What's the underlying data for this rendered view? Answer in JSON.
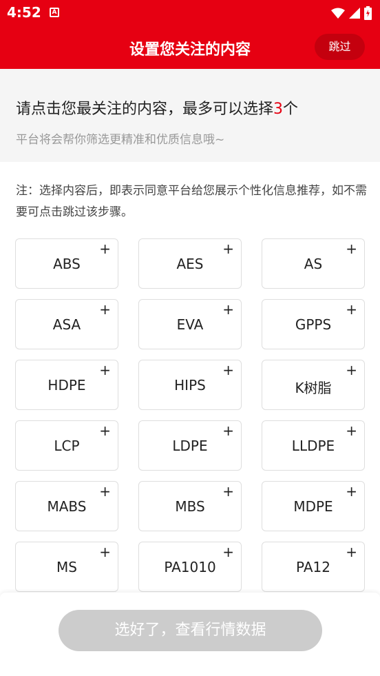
{
  "status_bar": {
    "time": "4:52",
    "notification_icon": "A"
  },
  "app_bar": {
    "title": "设置您关注的内容",
    "skip_label": "跳过"
  },
  "intro": {
    "title_prefix": "请点击您最关注的内容，最多可以选择",
    "title_max": "3",
    "title_suffix": "个",
    "subtitle": "平台将会帮你筛选更精准和优质信息哦~"
  },
  "note": "注：选择内容后，即表示同意平台给您展示个性化信息推荐，如不需要可点击跳过该步骤。",
  "tags": [
    {
      "label": "ABS"
    },
    {
      "label": "AES"
    },
    {
      "label": "AS"
    },
    {
      "label": "ASA"
    },
    {
      "label": "EVA"
    },
    {
      "label": "GPPS"
    },
    {
      "label": "HDPE"
    },
    {
      "label": "HIPS"
    },
    {
      "label": "K树脂"
    },
    {
      "label": "LCP"
    },
    {
      "label": "LDPE"
    },
    {
      "label": "LLDPE"
    },
    {
      "label": "MABS"
    },
    {
      "label": "MBS"
    },
    {
      "label": "MDPE"
    },
    {
      "label": "MS"
    },
    {
      "label": "PA1010"
    },
    {
      "label": "PA12"
    }
  ],
  "tag_plus": "+",
  "footer": {
    "confirm_label": "选好了，查看行情数据"
  },
  "colors": {
    "brand": "#e60012",
    "disabled": "#cccccc",
    "muted": "#999999"
  }
}
